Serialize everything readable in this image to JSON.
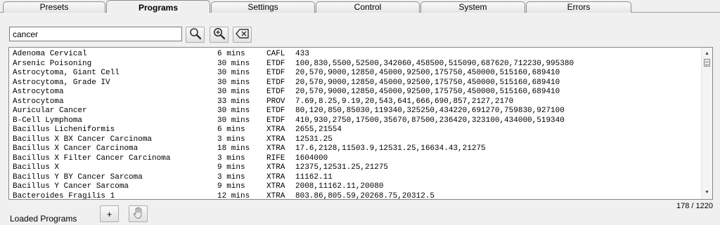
{
  "tabs": [
    {
      "label": "Presets",
      "active": false
    },
    {
      "label": "Programs",
      "active": true
    },
    {
      "label": "Settings",
      "active": false
    },
    {
      "label": "Control",
      "active": false
    },
    {
      "label": "System",
      "active": false
    },
    {
      "label": "Errors",
      "active": false
    }
  ],
  "search": {
    "value": "cancer"
  },
  "toolbar": {
    "search_icon": "magnifier-icon",
    "zoom_icon": "zoom-in-icon",
    "clear_icon": "clear-backspace-icon"
  },
  "programs": [
    {
      "name": "Adenoma Cervical",
      "duration": "6 mins",
      "type": "CAFL",
      "freqs": "433"
    },
    {
      "name": "Arsenic Poisoning",
      "duration": "30 mins",
      "type": "ETDF",
      "freqs": "100,830,5500,52500,342060,458500,515090,687620,712230,995380"
    },
    {
      "name": "Astrocytoma, Giant Cell",
      "duration": "30 mins",
      "type": "ETDF",
      "freqs": "20,570,9000,12850,45000,92500,175750,450000,515160,689410"
    },
    {
      "name": "Astrocytoma, Grade IV",
      "duration": "30 mins",
      "type": "ETDF",
      "freqs": "20,570,9000,12850,45000,92500,175750,450000,515160,689410"
    },
    {
      "name": "Astrocytoma",
      "duration": "30 mins",
      "type": "ETDF",
      "freqs": "20,570,9000,12850,45000,92500,175750,450000,515160,689410"
    },
    {
      "name": "Astrocytoma",
      "duration": "33 mins",
      "type": "PROV",
      "freqs": "7.69,8.25,9.19,20,543,641,666,690,857,2127,2170"
    },
    {
      "name": "Auricular Cancer",
      "duration": "30 mins",
      "type": "ETDF",
      "freqs": "80,120,850,85030,119340,325250,434220,691270,759830,927100"
    },
    {
      "name": "B-Cell Lymphoma",
      "duration": "30 mins",
      "type": "ETDF",
      "freqs": "410,930,2750,17500,35670,87500,236420,323100,434000,519340"
    },
    {
      "name": "Bacillus Licheniformis",
      "duration": "6 mins",
      "type": "XTRA",
      "freqs": "2655,21554"
    },
    {
      "name": "Bacillus X BX Cancer Carcinoma",
      "duration": "3 mins",
      "type": "XTRA",
      "freqs": "12531.25"
    },
    {
      "name": "Bacillus X Cancer Carcinoma",
      "duration": "18 mins",
      "type": "XTRA",
      "freqs": "17.6,2128,11503.9,12531.25,16634.43,21275"
    },
    {
      "name": "Bacillus X Filter Cancer Carcinoma",
      "duration": "3 mins",
      "type": "RIFE",
      "freqs": "1604000"
    },
    {
      "name": "Bacillus X",
      "duration": "9 mins",
      "type": "XTRA",
      "freqs": "12375,12531.25,21275"
    },
    {
      "name": "Bacillus Y BY Cancer Sarcoma",
      "duration": "3 mins",
      "type": "XTRA",
      "freqs": "11162.11"
    },
    {
      "name": "Bacillus Y Cancer Sarcoma",
      "duration": "9 mins",
      "type": "XTRA",
      "freqs": "2008,11162.11,20080"
    },
    {
      "name": "Bacteroides Fragilis 1",
      "duration": "12 mins",
      "type": "XTRA",
      "freqs": "803.86,805.59,20268.75,20312.5"
    }
  ],
  "status": {
    "count": "178 / 1220"
  },
  "footer": {
    "loaded_label": "Loaded Programs",
    "add_label": "+",
    "hand_icon": "hand-icon"
  }
}
